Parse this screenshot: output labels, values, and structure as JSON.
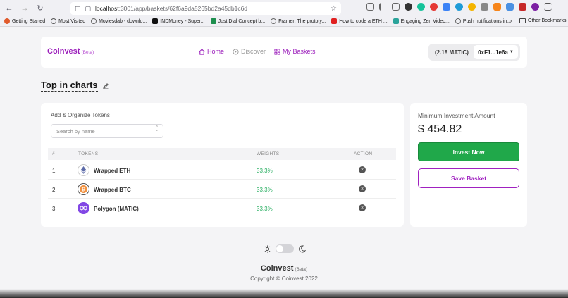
{
  "browser": {
    "url_host": "localhost",
    "url_path": ":3001/app/baskets/62f6a9da5265bd2a45db1c6d",
    "bookmarks": [
      {
        "label": "Getting Started",
        "color": "#e05a2b"
      },
      {
        "label": "Most Visited",
        "color": "#555555"
      },
      {
        "label": "Moviesdab - downlo...",
        "color": "#666666"
      },
      {
        "label": "INDMoney - Super...",
        "color": "#111111"
      },
      {
        "label": "Just Dial Concept b...",
        "color": "#1e8f4e"
      },
      {
        "label": "Framer: The prototy...",
        "color": "#666666"
      },
      {
        "label": "How to code a ETH ...",
        "color": "#e02020"
      },
      {
        "label": "Engaging Zen Video...",
        "color": "#2aa39a"
      },
      {
        "label": "Push notifications in...",
        "color": "#666666"
      }
    ],
    "bookmarks_more": "»",
    "other_bookmarks": "Other Bookmarks"
  },
  "header": {
    "brand": "Coinvest",
    "beta": "(Beta)",
    "nav": {
      "home": "Home",
      "discover": "Discover",
      "baskets": "My Baskets"
    },
    "wallet": {
      "balance": "(2.18 MATIC)",
      "address": "0xF1...1e6a"
    }
  },
  "page": {
    "title": "Top in charts"
  },
  "tokens": {
    "section_label": "Add & Organize Tokens",
    "search_placeholder": "Search by name",
    "columns": {
      "index": "#",
      "tokens": "TOKENS",
      "weights": "WEIGHTS",
      "action": "ACTION"
    },
    "rows": [
      {
        "index": "1",
        "name": "Wrapped ETH",
        "weight": "33.3%",
        "icon": "eth-icon",
        "icon_color": "#ffffff"
      },
      {
        "index": "2",
        "name": "Wrapped BTC",
        "weight": "33.3%",
        "icon": "btc-icon",
        "icon_color": "#f09242"
      },
      {
        "index": "3",
        "name": "Polygon (MATIC)",
        "weight": "33.3%",
        "icon": "matic-icon",
        "icon_color": "#8247e5"
      }
    ]
  },
  "investment": {
    "label": "Minimum Investment Amount",
    "amount": "$ 454.82",
    "invest_button": "Invest Now",
    "save_button": "Save Basket"
  },
  "footer": {
    "brand": "Coinvest",
    "beta": "(Beta)",
    "copyright": "Copyright © Coinvest 2022"
  }
}
